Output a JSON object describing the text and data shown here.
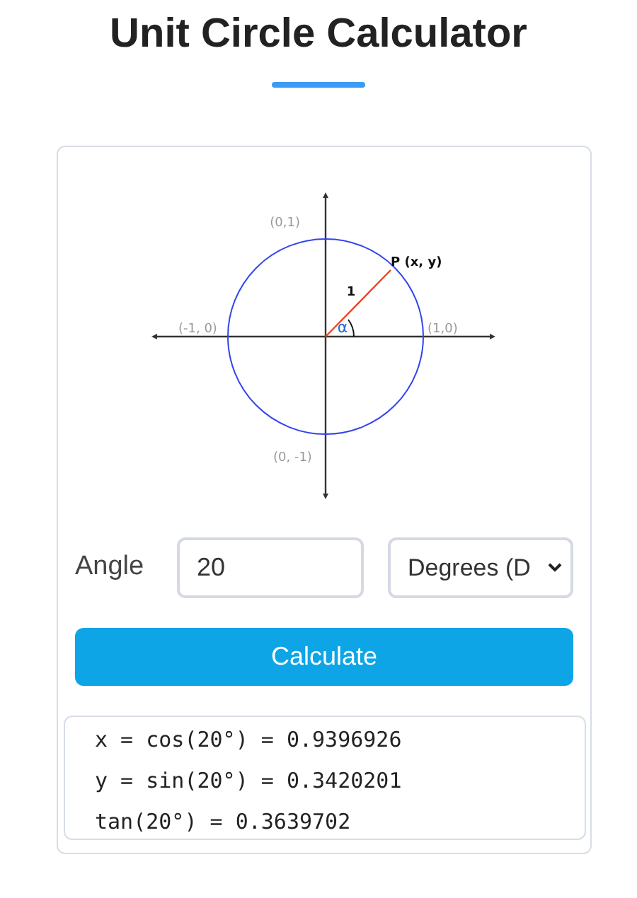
{
  "title": "Unit Circle Calculator",
  "diagram": {
    "labels": [
      {
        "kind": "top",
        "text": "(0,1)"
      },
      {
        "kind": "point",
        "text": "P (x, y)"
      },
      {
        "kind": "radius",
        "text": "1"
      },
      {
        "kind": "left",
        "text": "(-1, 0)"
      },
      {
        "kind": "angle",
        "text": "α"
      },
      {
        "kind": "right",
        "text": "(1,0)"
      },
      {
        "kind": "bottom",
        "text": "(0, -1)"
      }
    ]
  },
  "form": {
    "label": "Angle",
    "angle_value": "20",
    "unit": "Degrees (D",
    "button": "Calculate"
  },
  "results": [
    "x = cos(20°) = 0.9396926",
    "y = sin(20°) = 0.3420201",
    "tan(20°) = 0.3639702"
  ]
}
